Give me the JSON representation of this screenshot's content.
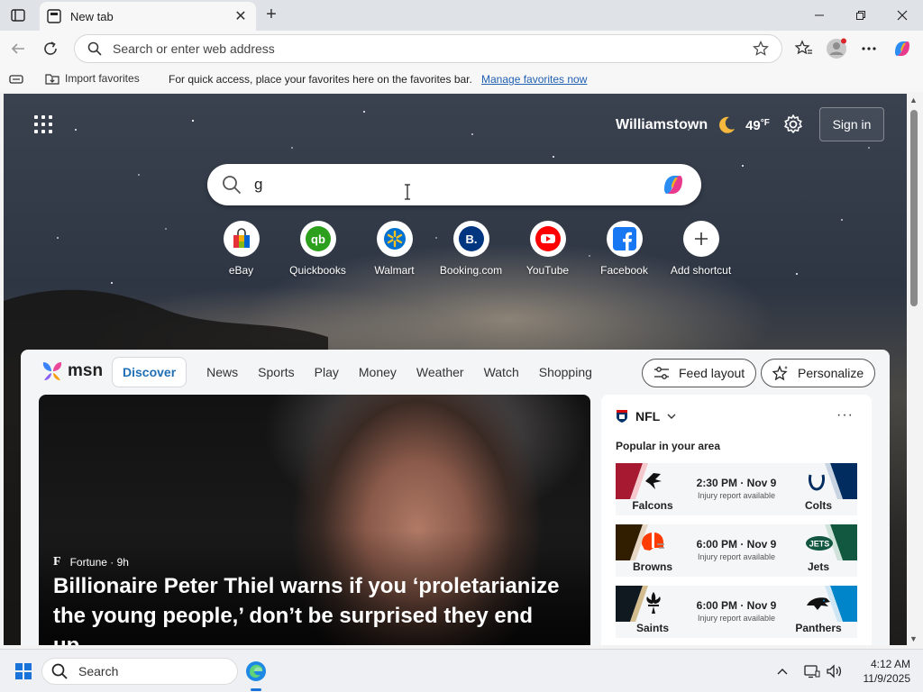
{
  "browser": {
    "tab_title": "New tab",
    "address_placeholder": "Search or enter web address"
  },
  "favorites_bar": {
    "import_label": "Import favorites",
    "message": "For quick access, place your favorites here on the favorites bar.",
    "manage_link": "Manage favorites now"
  },
  "header": {
    "city": "Williamstown",
    "temperature": "49",
    "temp_unit": "°F",
    "sign_in": "Sign in"
  },
  "search": {
    "value": "g"
  },
  "shortcuts": [
    {
      "name": "eBay"
    },
    {
      "name": "Quickbooks"
    },
    {
      "name": "Walmart"
    },
    {
      "name": "Booking.com"
    },
    {
      "name": "YouTube"
    },
    {
      "name": "Facebook"
    },
    {
      "name": "Add shortcut"
    }
  ],
  "msn": {
    "logo": "msn",
    "tabs": [
      "Discover",
      "News",
      "Sports",
      "Play",
      "Money",
      "Weather",
      "Watch",
      "Shopping"
    ],
    "feed_layout": "Feed layout",
    "personalize": "Personalize"
  },
  "hero": {
    "source": "Fortune · 9h",
    "source_logo": "F",
    "headline": "Billionaire Peter Thiel warns if you ‘proletarianize the young people,’ don’t be surprised they end up..."
  },
  "nfl": {
    "title": "NFL",
    "subtitle": "Popular in your area",
    "games": [
      {
        "home": "Falcons",
        "away": "Colts",
        "time": "2:30 PM · Nov 9",
        "note": "Injury report available",
        "colorL": "#a71930",
        "colorR": "#002c5f"
      },
      {
        "home": "Browns",
        "away": "Jets",
        "time": "6:00 PM · Nov 9",
        "note": "Injury report available",
        "colorL": "#311d00",
        "colorR": "#125740"
      },
      {
        "home": "Saints",
        "away": "Panthers",
        "time": "6:00 PM · Nov 9",
        "note": "Injury report available",
        "colorL": "#101820",
        "colorR": "#0085ca"
      }
    ]
  },
  "taskbar": {
    "search": "Search",
    "time": "4:12 AM",
    "date": "11/9/2025"
  }
}
